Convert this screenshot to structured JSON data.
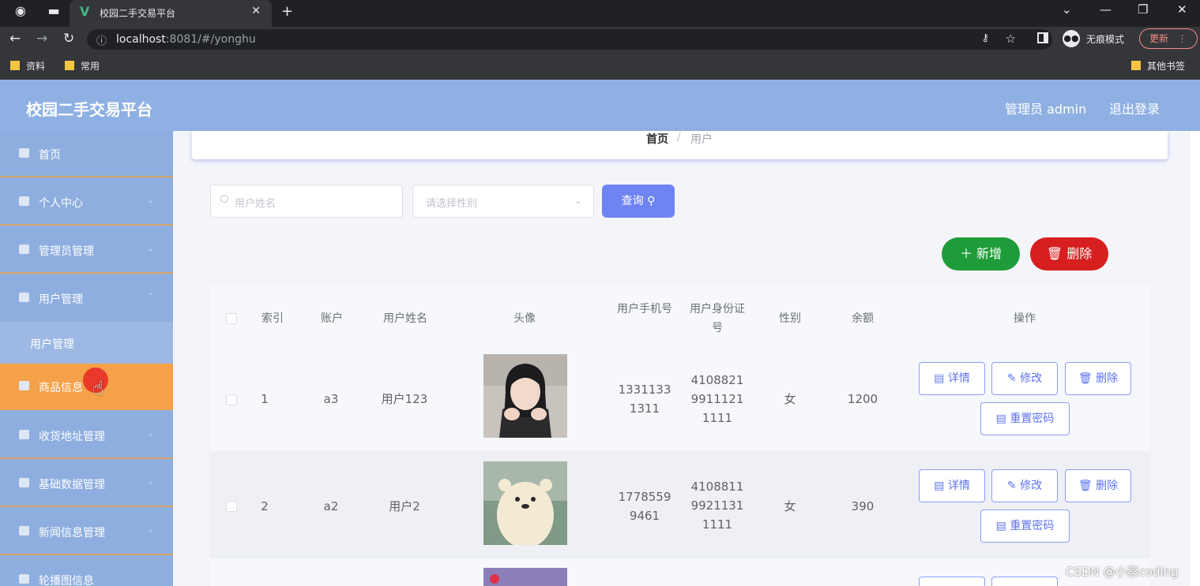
{
  "browser": {
    "tab_title": "校园二手交易平台",
    "tab_favicon": "V",
    "url_host": "localhost",
    "url_rest": ":8081/#/yonghu",
    "incognito_label": "无痕模式",
    "update_label": "更新",
    "bookmarks": [
      "资料",
      "常用"
    ],
    "other_bookmarks": "其他书签"
  },
  "header": {
    "title": "校园二手交易平台",
    "admin": "管理员 admin",
    "logout": "退出登录"
  },
  "sidebar": {
    "items": [
      {
        "label": "首页"
      },
      {
        "label": "个人中心"
      },
      {
        "label": "管理员管理"
      },
      {
        "label": "用户管理"
      },
      {
        "label": "用户管理"
      },
      {
        "label": "商品信息"
      },
      {
        "label": "收货地址管理"
      },
      {
        "label": "基础数据管理"
      },
      {
        "label": "新闻信息管理"
      },
      {
        "label": "轮播图信息"
      }
    ]
  },
  "breadcrumb": {
    "home": "首页",
    "separator": "/",
    "current": "用户"
  },
  "search": {
    "name_placeholder": "用户姓名",
    "gender_placeholder": "请选择性别",
    "query_label": "查询"
  },
  "actions": {
    "add": "新增",
    "delete": "删除"
  },
  "table": {
    "headers": [
      "索引",
      "账户",
      "用户姓名",
      "头像",
      "用户手机号",
      "用户身份证号",
      "性别",
      "余额",
      "操作"
    ],
    "rows": [
      {
        "index": "1",
        "account": "a3",
        "name": "用户123",
        "phone": "13311331311",
        "id_card": "410882199111211111",
        "gender": "女",
        "balance": "1200"
      },
      {
        "index": "2",
        "account": "a2",
        "name": "用户2",
        "phone": "17785599461",
        "id_card": "410881199211311111",
        "gender": "女",
        "balance": "390"
      }
    ],
    "op_buttons": {
      "detail": "详情",
      "edit": "修改",
      "delete": "删除",
      "reset": "重置密码"
    }
  },
  "watermark": "CSDN @小蔡coding",
  "colors": {
    "header_bg": "#8fb0e3",
    "sidebar_bg": "#8eaedf",
    "active_menu": "#f5a14a",
    "primary": "#6e84f2",
    "success": "#1f9c3a",
    "danger": "#d71f1f"
  }
}
